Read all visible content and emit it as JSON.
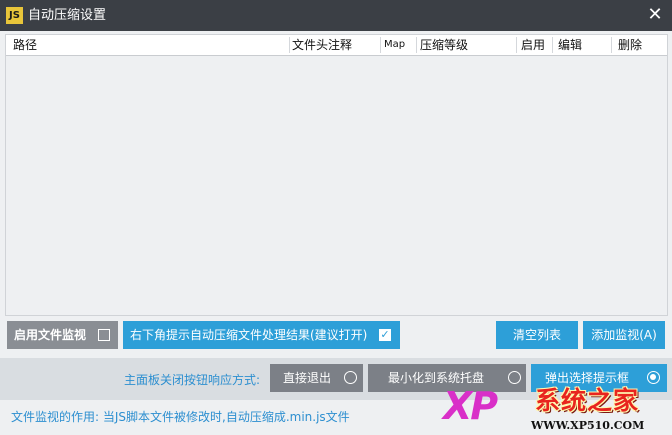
{
  "window": {
    "icon_text": "JS",
    "title": "自动压缩设置",
    "close_glyph": "✕"
  },
  "table": {
    "columns": [
      "路径",
      "文件头注释",
      "Map",
      "压缩等级",
      "启用",
      "编辑",
      "删除"
    ],
    "rows": []
  },
  "controls": {
    "enable_monitor_label": "启用文件监视",
    "enable_monitor_checked": false,
    "notify_label": "右下角提示自动压缩文件处理结果(建议打开)",
    "notify_checked": true,
    "clear_list_label": "清空列表",
    "add_monitor_label": "添加监视(A)"
  },
  "close_behavior": {
    "label": "主面板关闭按钮响应方式:",
    "options": [
      {
        "label": "直接退出",
        "selected": false
      },
      {
        "label": "最小化到系统托盘",
        "selected": false
      },
      {
        "label": "弹出选择提示框",
        "selected": true
      }
    ]
  },
  "footer_text": "文件监视的作用: 当JS脚本文件被修改时,自动压缩成.min.js文件",
  "watermark": {
    "brand": "XP",
    "name": "系统之家",
    "url": "WWW.XP510.COM",
    "colors": {
      "xp": "#d92fc8",
      "name": "#e8241e"
    }
  },
  "colors": {
    "titlebar": "#3b3f45",
    "accent_blue": "#2d9fd8",
    "gray_button": "#8a8e94",
    "link_blue": "#2d8fd0"
  }
}
